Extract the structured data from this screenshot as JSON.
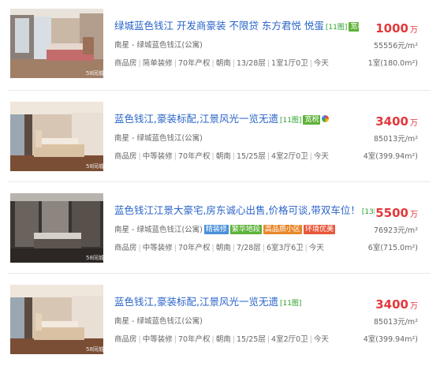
{
  "listings": [
    {
      "title": "绿城蓝色钱江  开发商豪装 不限贷 东方君悦 悦蛋",
      "photo_count": "[11图]",
      "tags": [
        {
          "text": "宽税",
          "color": "green"
        }
      ],
      "has_circle_icon": true,
      "address": "南星 - 绿城蓝色钱江(公寓)",
      "meta": [
        "商品房",
        "简单装修",
        "70年产权",
        "朝南",
        "13/28层",
        "1室1厅0卫",
        "今天"
      ],
      "price": "1000",
      "price_unit": "万",
      "unit_price": "55556元/m²",
      "layout": "1室(180.0m²)"
    },
    {
      "title": "蓝色钱江,豪装标配,江景风光一览无遗",
      "photo_count": "[11图]",
      "tags": [
        {
          "text": "宽税",
          "color": "green"
        }
      ],
      "has_circle_icon": true,
      "address": "南星 - 绿城蓝色钱江(公寓)",
      "meta": [
        "商品房",
        "中等装修",
        "70年产权",
        "朝南",
        "15/25层",
        "4室2厅0卫",
        "今天"
      ],
      "price": "3400",
      "price_unit": "万",
      "unit_price": "85013元/m²",
      "layout": "4室(399.94m²)"
    },
    {
      "title": "蓝色钱江江景大豪宅,房东诚心出售,价格可谈,带双车位！",
      "photo_count": "[13图]",
      "tags": [],
      "has_circle_icon": false,
      "address": "南星 - 绿城蓝色钱江(公寓)",
      "address_tags": [
        {
          "text": "精装修",
          "color": "blue"
        },
        {
          "text": "繁华地段",
          "color": "green"
        },
        {
          "text": "高品质小区",
          "color": "orange"
        },
        {
          "text": "环境优美",
          "color": "red"
        }
      ],
      "meta": [
        "商品房",
        "中等装修",
        "70年产权",
        "朝南",
        "7/28层",
        "6室3厅6卫",
        "今天"
      ],
      "price": "5500",
      "price_unit": "万",
      "unit_price": "76923元/m²",
      "layout": "6室(715.0m²)"
    },
    {
      "title": "蓝色钱江,豪装标配,江景风光一览无遗",
      "photo_count": "[11图]",
      "tags": [],
      "has_circle_icon": false,
      "address": "南星 - 绿城蓝色钱江(公寓)",
      "meta": [
        "商品房",
        "中等装修",
        "70年产权",
        "朝南",
        "15/25层",
        "4室2厅0卫",
        "今天"
      ],
      "price": "3400",
      "price_unit": "万",
      "unit_price": "85013元/m²",
      "layout": "4室(399.94m²)"
    }
  ],
  "watermark": "58同城",
  "colors": {
    "title": "#2a64c8",
    "price": "#e4393c",
    "photo_count": "#2aa02a"
  }
}
